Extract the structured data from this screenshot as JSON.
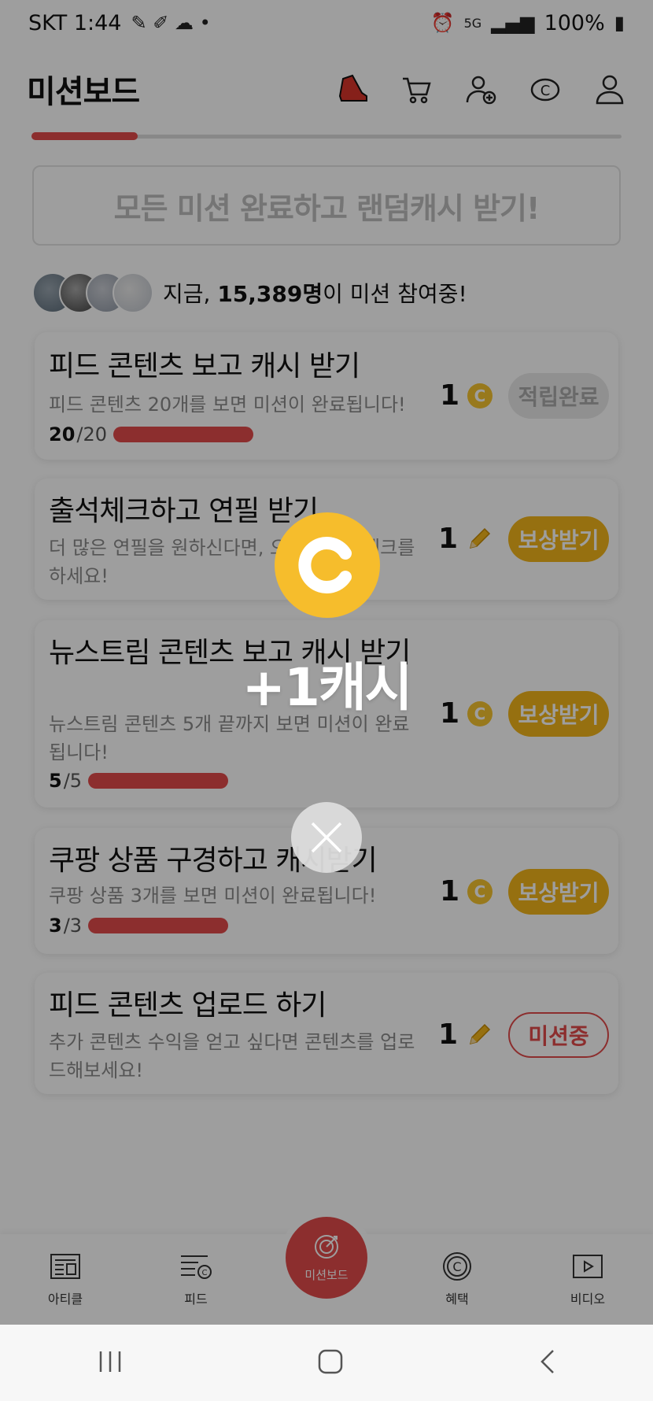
{
  "status_bar": {
    "carrier_time": "SKT 1:44",
    "battery": "100%",
    "network": "5G"
  },
  "header": {
    "title": "미션보드",
    "icons": [
      "shoe-icon",
      "cart-icon",
      "add-friend-icon",
      "cash-coin-icon",
      "profile-icon"
    ]
  },
  "progress": {
    "completed_fraction": 0.18
  },
  "all_missions_banner": "모든 미션 완료하고 랜덤캐시 받기!",
  "participants": {
    "prefix": "지금, ",
    "count": "15,389명",
    "suffix": "이 미션 참여중!"
  },
  "missions": [
    {
      "title": "피드 콘텐츠 보고 캐시 받기",
      "desc": "피드 콘텐츠 20개를 보면 미션이 완료됩니다!",
      "progress_done": "20",
      "progress_total": "/20",
      "progress_fraction": 1.0,
      "reward_amount": "1",
      "reward_icon": "coin",
      "button": "적립완료",
      "button_state": "done"
    },
    {
      "title": "출석체크하고 연필 받기",
      "desc": "더 많은 연필을 원하신다면, 오늘도 출석체크를 하세요!",
      "reward_amount": "1",
      "reward_icon": "pencil",
      "button": "보상받기",
      "button_state": "reward"
    },
    {
      "title": "뉴스트림 콘텐츠 보고 캐시 받기",
      "desc": "뉴스트림 콘텐츠 5개 끝까지 보면 미션이 완료됩니다!",
      "progress_done": "5",
      "progress_total": "/5",
      "progress_fraction": 1.0,
      "reward_amount": "1",
      "reward_icon": "coin",
      "button": "보상받기",
      "button_state": "reward"
    },
    {
      "title": "쿠팡 상품 구경하고 캐시받기",
      "desc": "쿠팡 상품 3개를 보면 미션이 완료됩니다!",
      "progress_done": "3",
      "progress_total": "/3",
      "progress_fraction": 1.0,
      "reward_amount": "1",
      "reward_icon": "coin",
      "button": "보상받기",
      "button_state": "reward"
    },
    {
      "title": "피드 콘텐츠 업로드 하기",
      "desc": "추가 콘텐츠 수익을 얻고 싶다면 콘텐츠를 업로드해보세요!",
      "reward_amount": "1",
      "reward_icon": "pencil",
      "button": "미션중",
      "button_state": "in-progress"
    }
  ],
  "bottom_nav": {
    "article": "아티클",
    "feed": "피드",
    "mission_board": "미션보드",
    "benefits": "혜택",
    "video": "비디오"
  },
  "popup": {
    "text": "+1캐시",
    "icon": "cash-coin-icon"
  },
  "colors": {
    "accent_red": "#e24b4b",
    "coin_yellow": "#f6bd2c",
    "reward_button": "#f3b51b"
  }
}
